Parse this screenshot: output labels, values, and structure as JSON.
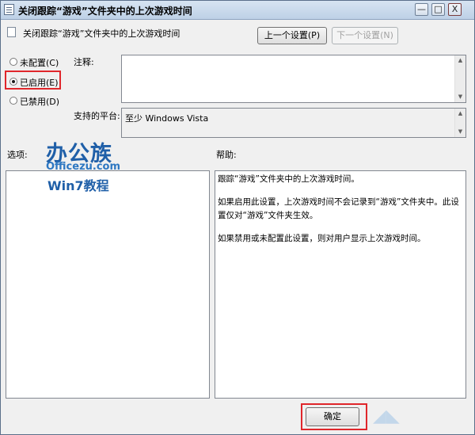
{
  "window": {
    "title": "关闭跟踪“游戏”文件夹中的上次游戏时间",
    "controls": {
      "minimize": "—",
      "maximize": "□",
      "close": "X"
    }
  },
  "header": {
    "policy_name": "关闭跟踪“游戏”文件夹中的上次游戏时间",
    "prev_button": "上一个设置(P)",
    "next_button": "下一个设置(N)"
  },
  "state": {
    "options": [
      {
        "label": "未配置(C)",
        "checked": false
      },
      {
        "label": "已启用(E)",
        "checked": true
      },
      {
        "label": "已禁用(D)",
        "checked": false
      }
    ]
  },
  "comment": {
    "label": "注释:",
    "value": ""
  },
  "platform": {
    "label": "支持的平台:",
    "value": "至少 Windows Vista"
  },
  "options_section": {
    "label": "选项:"
  },
  "help_section": {
    "label": "帮助:",
    "paragraphs": [
      "跟踪“游戏”文件夹中的上次游戏时间。",
      "如果启用此设置，上次游戏时间不会记录到“游戏”文件夹中。此设置仅对“游戏”文件夹生效。",
      "如果禁用或未配置此设置，则对用户显示上次游戏时间。"
    ]
  },
  "footer": {
    "ok_button": "确定"
  },
  "watermark": {
    "logo_main": "办公族",
    "logo_site": "Officezu.com",
    "logo_sub": "Win7教程"
  },
  "colors": {
    "highlight": "#e0262b",
    "logo": "#1f5fa8"
  },
  "icons": [
    "policy-icon",
    "minimize-icon",
    "maximize-icon",
    "close-icon",
    "scroll-up-icon",
    "scroll-down-icon"
  ]
}
